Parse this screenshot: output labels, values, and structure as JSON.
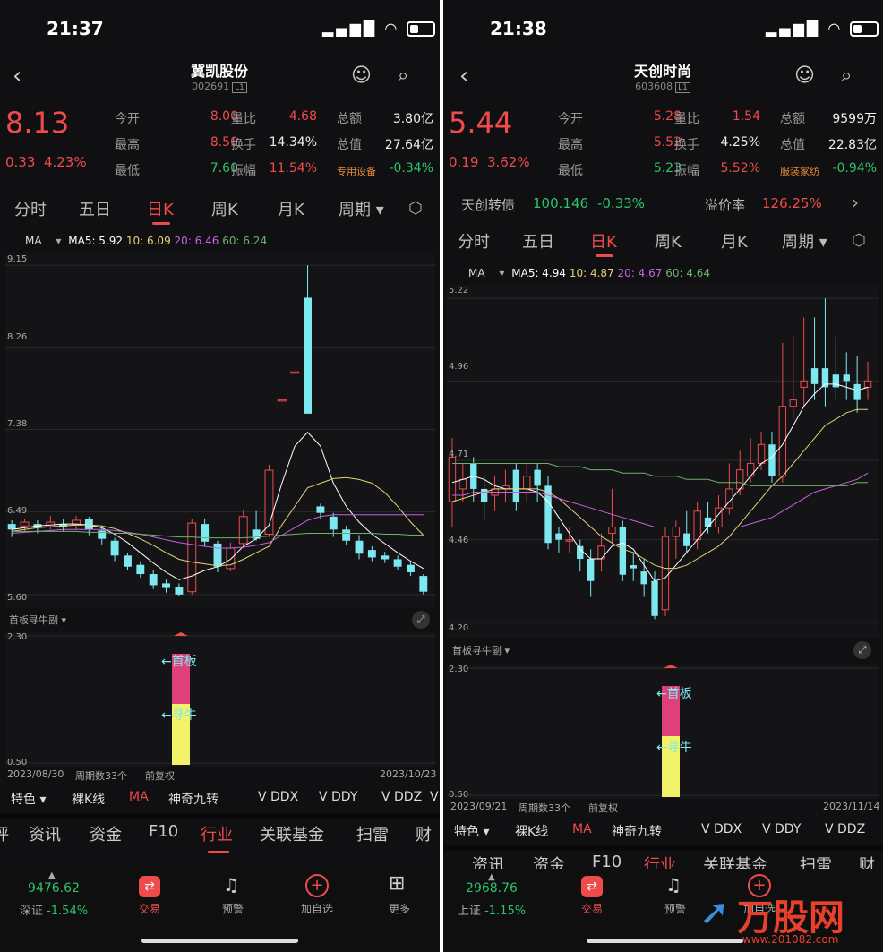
{
  "left": {
    "status": {
      "time": "21:37"
    },
    "header": {
      "name": "冀凯股份",
      "code": "002691",
      "level": "L1"
    },
    "quote": {
      "price": "8.13",
      "change": "0.33",
      "change_pct": "4.23%",
      "rows": [
        [
          {
            "k": "今开",
            "v": "8.00",
            "c": "red"
          },
          {
            "k": "量比",
            "v": "4.68",
            "c": "red"
          },
          {
            "k": "总额",
            "v": "3.80亿",
            "c": "white"
          }
        ],
        [
          {
            "k": "最高",
            "v": "8.50",
            "c": "red"
          },
          {
            "k": "换手",
            "v": "14.34%",
            "c": "white"
          },
          {
            "k": "总值",
            "v": "27.64亿",
            "c": "white"
          }
        ],
        [
          {
            "k": "最低",
            "v": "7.60",
            "c": "green"
          },
          {
            "k": "振幅",
            "v": "11.54%",
            "c": "red"
          },
          {
            "k": "专用设备",
            "v": "-0.34%",
            "c": "green"
          }
        ]
      ]
    },
    "period_tabs": [
      "分时",
      "五日",
      "日K",
      "周K",
      "月K",
      "周期 ▾"
    ],
    "active_tab": 2,
    "ma": {
      "label": "MA",
      "ma5": "MA5: 5.92",
      "ma10": "10: 6.09",
      "ma20": "20: 6.46",
      "ma60": "60: 6.24"
    },
    "yaxis": [
      "9.15",
      "8.26",
      "7.38",
      "6.49",
      "5.60"
    ],
    "sub": {
      "title": "首板寻牛副 ▾",
      "top": "2.30",
      "bottom": "0.50",
      "label1": "←首板",
      "label2": "←寻牛",
      "start_date": "2023/08/30",
      "cycles": "周期数33个",
      "adj": "前复权",
      "end_date": "2023/10/23"
    },
    "feature_tabs": [
      "特色 ▾",
      "裸K线",
      "MA",
      "神奇九转",
      "V DDX",
      "V DDY",
      "V DDZ",
      "V"
    ],
    "news_tabs": [
      "评",
      "资讯",
      "资金",
      "F10",
      "行业",
      "关联基金",
      "扫雷",
      "财"
    ],
    "news_active": 4,
    "bottom": {
      "index_value": "9476.62",
      "index_name": "深证",
      "index_pct": "-1.54%",
      "nav": [
        "交易",
        "预警",
        "加自选",
        "更多"
      ]
    }
  },
  "right": {
    "status": {
      "time": "21:38"
    },
    "header": {
      "name": "天创时尚",
      "code": "603608",
      "level": "L1"
    },
    "quote": {
      "price": "5.44",
      "change": "0.19",
      "change_pct": "3.62%",
      "rows": [
        [
          {
            "k": "今开",
            "v": "5.28",
            "c": "red"
          },
          {
            "k": "量比",
            "v": "1.54",
            "c": "red"
          },
          {
            "k": "总额",
            "v": "9599万",
            "c": "white"
          }
        ],
        [
          {
            "k": "最高",
            "v": "5.52",
            "c": "red"
          },
          {
            "k": "换手",
            "v": "4.25%",
            "c": "white"
          },
          {
            "k": "总值",
            "v": "22.83亿",
            "c": "white"
          }
        ],
        [
          {
            "k": "最低",
            "v": "5.23",
            "c": "green"
          },
          {
            "k": "振幅",
            "v": "5.52%",
            "c": "red"
          },
          {
            "k": "服装家纺",
            "v": "-0.94%",
            "c": "green"
          }
        ]
      ]
    },
    "bond": {
      "name": "天创转债",
      "price": "100.146",
      "pct": "-0.33%",
      "premium_label": "溢价率",
      "premium": "126.25%"
    },
    "period_tabs": [
      "分时",
      "五日",
      "日K",
      "周K",
      "月K",
      "周期 ▾"
    ],
    "active_tab": 2,
    "ma": {
      "label": "MA",
      "ma5": "MA5: 4.94",
      "ma10": "10: 4.87",
      "ma20": "20: 4.67",
      "ma60": "60: 4.64"
    },
    "yaxis": [
      "5.22",
      "4.96",
      "4.71",
      "4.46",
      "4.20"
    ],
    "sub": {
      "title": "首板寻牛副 ▾",
      "top": "2.30",
      "bottom": "0.50",
      "label1": "←首板",
      "label2": "←寻牛",
      "start_date": "2023/09/21",
      "cycles": "周期数33个",
      "adj": "前复权",
      "end_date": "2023/11/14"
    },
    "feature_tabs": [
      "特色 ▾",
      "裸K线",
      "MA",
      "神奇九转",
      "V DDX",
      "V DDY",
      "V DDZ"
    ],
    "news_tabs": [
      "资讯",
      "资金",
      "F10",
      "行业",
      "关联基金",
      "扫雷",
      "财"
    ],
    "news_active": 3,
    "bottom": {
      "index_value": "2968.76",
      "index_name": "上证",
      "index_pct": "-1.15%",
      "nav": [
        "交易",
        "预警",
        "加自选"
      ]
    }
  },
  "watermark": {
    "brand": "万股网",
    "url": "www.201082.com"
  },
  "colors": {
    "up": "#ef4b4b",
    "down": "#7ee8f0",
    "ma5": "#ffffff",
    "ma10": "#e3d27a",
    "ma20": "#c860e0",
    "ma60": "#6bb36b",
    "sub_pink": "#e0407a",
    "sub_yellow": "#f3f36a"
  }
}
